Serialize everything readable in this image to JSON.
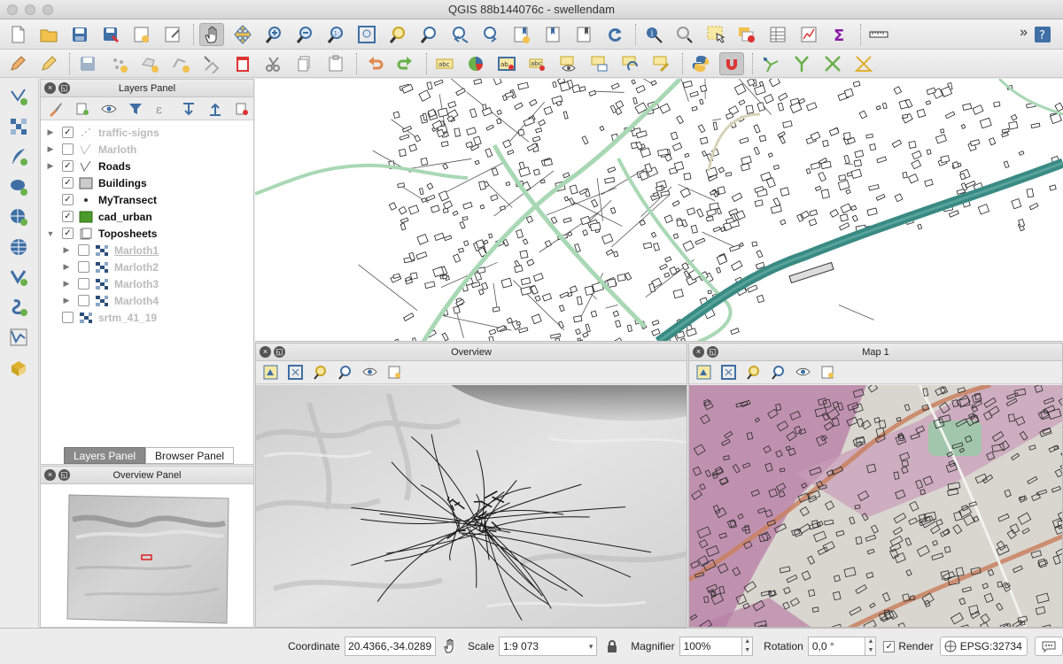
{
  "window": {
    "title": "QGIS 88b144076c - swellendam"
  },
  "toolbar1": {
    "icons": [
      "new-project-icon",
      "open-project-icon",
      "save-project-icon",
      "save-as-icon",
      "new-print-layout-icon",
      "layout-manager-icon",
      "pan-icon",
      "pan-to-selection-icon",
      "zoom-in-icon",
      "zoom-out-icon",
      "zoom-native-icon",
      "zoom-full-icon",
      "zoom-to-selection-icon",
      "zoom-to-layer-icon",
      "zoom-last-icon",
      "zoom-next-icon",
      "new-bookmark-icon",
      "show-bookmarks-icon",
      "show-map-tips-icon",
      "refresh-icon",
      "identify-icon",
      "select-tools-icon",
      "select-feature-icon",
      "deselect-icon",
      "attribute-table-icon",
      "field-calculator-icon",
      "statistics-icon",
      "measure-icon",
      "help-icon"
    ],
    "overflow": "»"
  },
  "toolbar2": {
    "icons": [
      "current-edits-icon",
      "toggle-editing-icon",
      "save-edits-icon",
      "add-point-icon",
      "move-feature-icon",
      "node-tool-icon",
      "delete-selected-icon",
      "cut-features-icon",
      "copy-features-icon",
      "paste-features-icon",
      "undo-icon",
      "redo-icon",
      "label-icon",
      "diagram-icon",
      "highlight-pinned-label-icon",
      "pin-label-icon",
      "show-hide-label-icon",
      "move-label-icon",
      "rotate-label-icon",
      "change-label-icon",
      "python-console-icon",
      "snapping-icon",
      "digitize-icon",
      "trace-icon",
      "split-icon",
      "merge-icon"
    ]
  },
  "left_toolbar": {
    "icons": [
      "add-vector-layer-icon",
      "add-raster-layer-icon",
      "add-delimited-text-icon",
      "add-postgis-layer-icon",
      "add-wms-layer-icon",
      "add-wcs-layer-icon",
      "add-wfs-layer-icon",
      "add-spatialite-layer-icon",
      "add-virtual-layer-icon",
      "add-mssql-layer-icon"
    ]
  },
  "layers_panel": {
    "title": "Layers Panel",
    "tools": [
      "open-layer-styling-icon",
      "add-group-icon",
      "manage-visibility-icon",
      "filter-legend-icon",
      "filter-expression-icon",
      "expand-all-icon",
      "collapse-all-icon",
      "remove-layer-icon"
    ],
    "layers": [
      {
        "name": "traffic-signs",
        "checked": true,
        "visible": false,
        "expander": "▶",
        "symbol": "points",
        "indent": 0
      },
      {
        "name": "Marloth",
        "checked": false,
        "visible": false,
        "expander": "▶",
        "symbol": "line",
        "indent": 0
      },
      {
        "name": "Roads",
        "checked": true,
        "visible": true,
        "expander": "▶",
        "symbol": "line",
        "indent": 0
      },
      {
        "name": "Buildings",
        "checked": true,
        "visible": true,
        "expander": "",
        "symbol": "grey-fill",
        "indent": 0
      },
      {
        "name": "MyTransect",
        "checked": true,
        "visible": true,
        "expander": "",
        "symbol": "dot",
        "indent": 0
      },
      {
        "name": "cad_urban",
        "checked": true,
        "visible": true,
        "expander": "",
        "symbol": "green-fill",
        "indent": 0
      },
      {
        "name": "Toposheets",
        "checked": true,
        "visible": true,
        "expander": "▼",
        "symbol": "group",
        "indent": 0
      },
      {
        "name": "Marloth1",
        "checked": false,
        "visible": false,
        "expander": "▶",
        "symbol": "raster",
        "indent": 1
      },
      {
        "name": "Marloth2",
        "checked": false,
        "visible": false,
        "expander": "▶",
        "symbol": "raster",
        "indent": 1
      },
      {
        "name": "Marloth3",
        "checked": false,
        "visible": false,
        "expander": "▶",
        "symbol": "raster",
        "indent": 1
      },
      {
        "name": "Marloth4",
        "checked": false,
        "visible": false,
        "expander": "▶",
        "symbol": "raster",
        "indent": 1
      },
      {
        "name": "srtm_41_19",
        "checked": false,
        "visible": false,
        "expander": "",
        "symbol": "raster",
        "indent": 0
      }
    ],
    "tabs": [
      "Layers Panel",
      "Browser Panel"
    ]
  },
  "overview_panel": {
    "title": "Overview Panel"
  },
  "docks": {
    "overview": {
      "title": "Overview",
      "tools": [
        "sync-view-icon",
        "zoom-full-icon",
        "zoom-to-selection-icon",
        "zoom-to-layer-icon",
        "set-map-theme-icon",
        "map-settings-icon"
      ]
    },
    "map1": {
      "title": "Map 1",
      "tools": [
        "sync-view-icon",
        "zoom-full-icon",
        "zoom-to-selection-icon",
        "zoom-to-layer-icon",
        "set-map-theme-icon",
        "map-settings-icon"
      ]
    }
  },
  "statusbar": {
    "coordinate_label": "Coordinate",
    "coordinate_value": "20.4366,-34.0289",
    "scale_label": "Scale",
    "scale_value": "1:9 073",
    "magnifier_label": "Magnifier",
    "magnifier_value": "100%",
    "rotation_label": "Rotation",
    "rotation_value": "0,0 °",
    "render_label": "Render",
    "render_checked": true,
    "crs": "EPSG:32734",
    "messages_icon": "messages-icon"
  },
  "colors": {
    "road_green": "#a9d8b4",
    "river_teal": "#3a8a84",
    "building": "#ffffff",
    "urban_pink": "#b97fa6"
  }
}
